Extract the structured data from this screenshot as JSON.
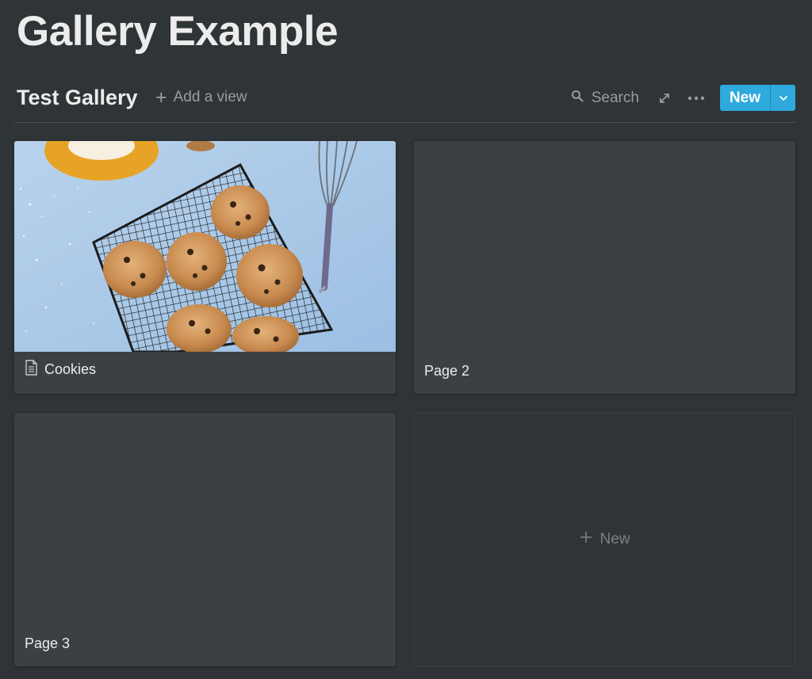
{
  "page": {
    "title": "Gallery Example"
  },
  "database": {
    "title": "Test Gallery",
    "add_view_label": "Add a view",
    "toolbar": {
      "search_label": "Search",
      "expand_icon": "expand-icon",
      "more_icon": "more-icon",
      "new_label": "New",
      "new_caret_icon": "chevron-down-icon"
    }
  },
  "cards": [
    {
      "title": "Cookies",
      "has_cover": true,
      "cover": "cookies-on-cooling-rack-photo",
      "icon": "page-icon"
    },
    {
      "title": "Page 2",
      "has_cover": false
    },
    {
      "title": "Page 3",
      "has_cover": false
    }
  ],
  "new_card": {
    "label": "New"
  },
  "colors": {
    "background": "#2f3437",
    "card": "#3b4043",
    "accent": "#2eaadc",
    "text": "#ececec",
    "muted": "#9b9c9e"
  }
}
